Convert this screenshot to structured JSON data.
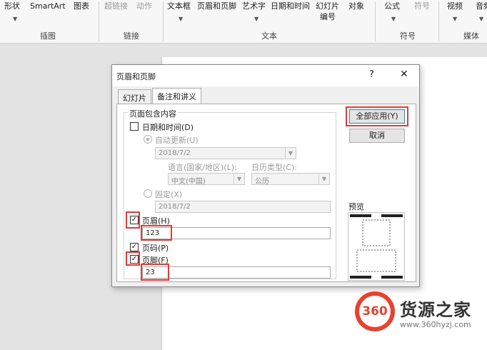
{
  "ribbon": {
    "buttons": {
      "shape": "形状",
      "smartart": "SmartArt",
      "chart": "图表",
      "hyperlink": "超链接",
      "action": "动作",
      "textbox": "文本框",
      "header_footer": "页眉和页脚",
      "wordart": "艺术字",
      "datetime": "日期和时间",
      "slide_number_1": "幻灯片",
      "slide_number_2": "编号",
      "object": "对象",
      "equation": "公式",
      "symbol": "符号",
      "video": "视频",
      "audio": "音频"
    },
    "groups": {
      "illustrations": "插图",
      "links": "链接",
      "text": "文本",
      "symbols": "符号",
      "media": "媒体"
    }
  },
  "dialog": {
    "title": "页眉和页脚",
    "help": "?",
    "close": "✕",
    "tabs": [
      "幻灯片",
      "备注和讲义"
    ],
    "group_title": "页面包含内容",
    "datetime": {
      "label": "日期和时间(D)",
      "checked": false,
      "auto_update_label": "自动更新(U)",
      "auto_date": "2018/7/2",
      "language_label": "语言(国家/地区)(L):",
      "calendar_label": "日历类型(C):",
      "language_value": "中文(中国)",
      "calendar_value": "公历",
      "fixed_label": "固定(X)",
      "fixed_value": "2018/7/2"
    },
    "header": {
      "label": "页眉(H)",
      "checked": true,
      "value": "123"
    },
    "page_number": {
      "label": "页码(P)",
      "checked": true
    },
    "footer": {
      "label": "页脚(F)",
      "checked": true,
      "value": "23"
    },
    "buttons": {
      "apply_all": "全部应用(Y)",
      "cancel": "取消"
    },
    "preview_label": "预览"
  },
  "watermark": {
    "logo": "360",
    "brand": "货源之家",
    "url": "www.360hyzj.com"
  },
  "colors": {
    "highlight": "#e53935",
    "logo_red": "#e8422e"
  }
}
